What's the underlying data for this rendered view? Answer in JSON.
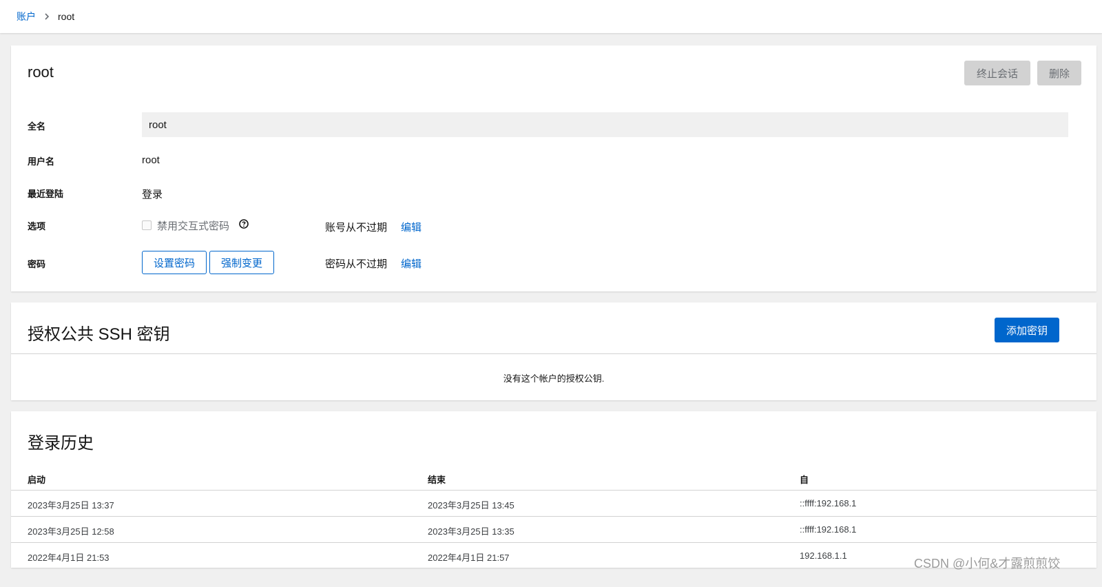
{
  "breadcrumb": {
    "parent": "账户",
    "current": "root"
  },
  "account": {
    "title": "root",
    "actions": {
      "terminate_session": "终止会话",
      "delete": "删除"
    },
    "fields": {
      "fullname_label": "全名",
      "fullname_value": "root",
      "username_label": "用户名",
      "username_value": "root",
      "last_login_label": "最近登陆",
      "last_login_value": "登录",
      "options_label": "选项",
      "disable_interactive_password": "禁用交互式密码",
      "account_expiry": "账号从不过期",
      "account_edit": "编辑",
      "password_label": "密码",
      "set_password": "设置密码",
      "force_change": "强制变更",
      "password_expiry": "密码从不过期",
      "password_edit": "编辑"
    }
  },
  "ssh": {
    "title": "授权公共 SSH 密钥",
    "add_key": "添加密钥",
    "empty_message": "没有这个帐户的授权公钥."
  },
  "history": {
    "title": "登录历史",
    "columns": [
      "启动",
      "结束",
      "自"
    ],
    "rows": [
      [
        "2023年3月25日 13:37",
        "2023年3月25日 13:45",
        "::ffff:192.168.1"
      ],
      [
        "2023年3月25日 12:58",
        "2023年3月25日 13:35",
        "::ffff:192.168.1"
      ],
      [
        "2022年4月1日 21:53",
        "2022年4月1日 21:57",
        "192.168.1.1"
      ]
    ]
  },
  "watermark": "CSDN @小何&才露煎煎饺",
  "icons": {
    "breadcrumb_separator": "chevron-right-icon",
    "help": "question-circle-icon"
  },
  "colors": {
    "link": "#0066cc",
    "primary_button": "#0066cc",
    "disabled_button": "#d2d2d2",
    "background": "#f0f0f0"
  }
}
